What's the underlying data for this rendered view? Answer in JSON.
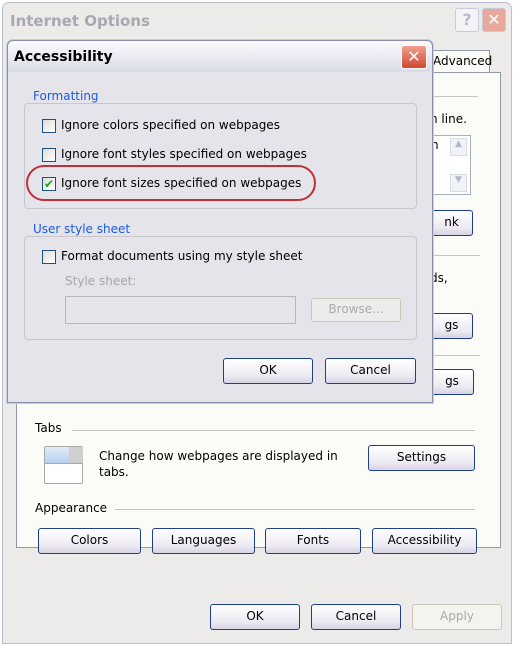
{
  "main_window": {
    "title": "Internet Options",
    "help_label": "?",
    "close_label": "✕",
    "tab_advanced": "Advanced",
    "partial_texts": {
      "line": "n line.",
      "listbox": "n",
      "button1": "nk",
      "text2": "ds,",
      "button2": "gs",
      "button3": "gs"
    },
    "tabs_section": {
      "header": "Tabs",
      "description": "Change how webpages are displayed in tabs.",
      "settings_label": "Settings"
    },
    "appearance_section": {
      "header": "Appearance",
      "buttons": [
        "Colors",
        "Languages",
        "Fonts",
        "Accessibility"
      ]
    },
    "footer": {
      "ok": "OK",
      "cancel": "Cancel",
      "apply": "Apply"
    }
  },
  "accessibility_dialog": {
    "title": "Accessibility",
    "close_label": "✕",
    "formatting": {
      "header": "Formatting",
      "options": [
        {
          "label": "Ignore colors specified on webpages",
          "checked": false
        },
        {
          "label": "Ignore font styles specified on webpages",
          "checked": false
        },
        {
          "label": "Ignore font sizes specified on webpages",
          "checked": true
        }
      ]
    },
    "user_style_sheet": {
      "header": "User style sheet",
      "option": {
        "label": "Format documents using my style sheet",
        "checked": false
      },
      "field_label": "Style sheet:",
      "field_value": "",
      "browse_label": "Browse..."
    },
    "ok": "OK",
    "cancel": "Cancel"
  },
  "colors": {
    "highlight_ellipse": "#c0303a",
    "group_label": "#1d5ce0",
    "check": "#21a121"
  }
}
